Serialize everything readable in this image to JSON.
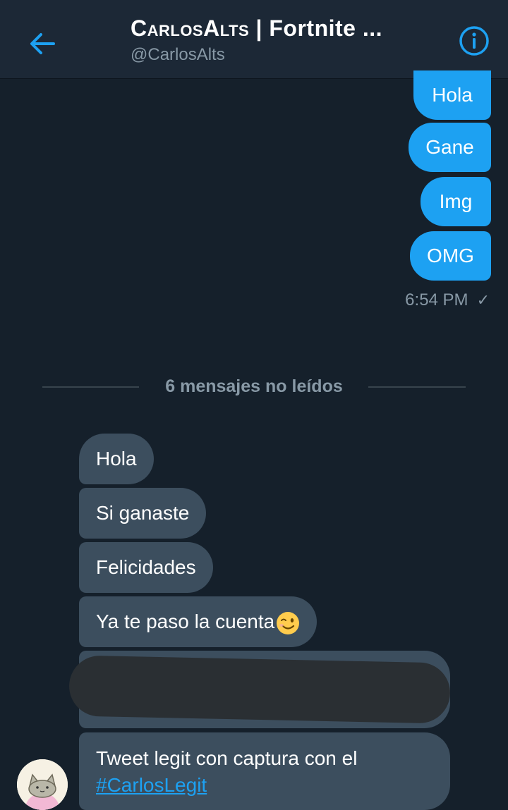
{
  "header": {
    "title_brand": "CarlosAlts",
    "title_rest": " | Fortnite ...",
    "handle": "@CarlosAlts",
    "back_icon": "arrow-left-icon",
    "info_icon": "info-circle-icon"
  },
  "outgoing": {
    "messages": [
      "Hola",
      "Gane",
      "Img",
      "OMG"
    ],
    "timestamp": "6:54 PM",
    "status_icon": "checkmark-icon"
  },
  "divider": {
    "label": "6 mensajes no leídos"
  },
  "incoming": {
    "messages": [
      "Hola",
      "Si ganaste",
      "Felicidades",
      "Ya te paso la cuenta"
    ],
    "emoji": "winking-face",
    "last_message_text": "Tweet legit con captura con el",
    "last_message_hashtag": "#CarlosLegit"
  },
  "colors": {
    "background": "#15202b",
    "header": "#1c2836",
    "accent": "#1da1f2",
    "incoming_bubble": "#3c4e5e",
    "muted_text": "#8899a6"
  }
}
